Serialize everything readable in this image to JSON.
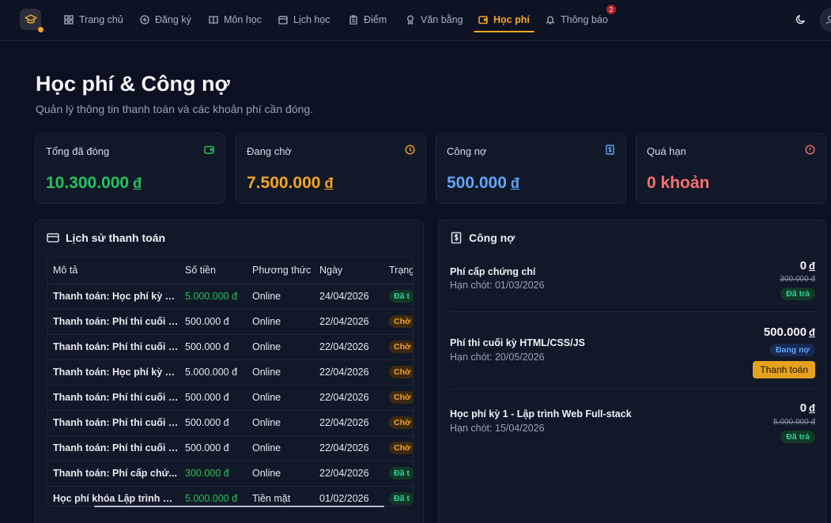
{
  "nav": {
    "items": [
      {
        "label": "Trang chủ",
        "icon": "grid-icon",
        "active": false
      },
      {
        "label": "Đăng ký",
        "icon": "plus-circle-icon",
        "active": false
      },
      {
        "label": "Môn học",
        "icon": "book-icon",
        "active": false
      },
      {
        "label": "Lịch học",
        "icon": "calendar-icon",
        "active": false
      },
      {
        "label": "Điểm",
        "icon": "clipboard-icon",
        "active": false
      },
      {
        "label": "Văn bằng",
        "icon": "award-icon",
        "active": false
      },
      {
        "label": "Học phí",
        "icon": "wallet-icon",
        "active": true
      },
      {
        "label": "Thông báo",
        "icon": "bell-icon",
        "active": false
      }
    ],
    "notif_count": "2",
    "accent": "#f5a524"
  },
  "header": {
    "title": "Học phí & Công nợ",
    "subtitle": "Quản lý thông tin thanh toán và các khoản phí cần đóng."
  },
  "stats": [
    {
      "label": "Tổng đã đóng",
      "value": "10.300.000",
      "currency": "đ",
      "color": "#22c55e",
      "icon": "wallet-icon"
    },
    {
      "label": "Đang chờ",
      "value": "7.500.000",
      "currency": "đ",
      "color": "#f5a524",
      "icon": "clock-icon"
    },
    {
      "label": "Công nợ",
      "value": "500.000",
      "currency": "đ",
      "color": "#60a5fa",
      "icon": "dollar-receipt-icon"
    },
    {
      "label": "Quá hạn",
      "value": "0 khoản",
      "currency": "",
      "color": "#f87171",
      "icon": "alert-circle-icon"
    }
  ],
  "history": {
    "title": "Lịch sử thanh toán",
    "columns": [
      "Mô tả",
      "Số tiền",
      "Phương thức",
      "Ngày",
      "Trạng"
    ],
    "rows": [
      {
        "desc": "Thanh toán: Học phí kỳ 1 ...",
        "amount": "5.000.000 đ",
        "green": true,
        "method": "Online",
        "date": "24/04/2026",
        "status": "Đã t",
        "status_type": "paid"
      },
      {
        "desc": "Thanh toán: Phí thi cuối k...",
        "amount": "500.000 đ",
        "green": false,
        "method": "Online",
        "date": "22/04/2026",
        "status": "Chờ",
        "status_type": "pending"
      },
      {
        "desc": "Thanh toán: Phí thi cuối k...",
        "amount": "500.000 đ",
        "green": false,
        "method": "Online",
        "date": "22/04/2026",
        "status": "Chờ",
        "status_type": "pending"
      },
      {
        "desc": "Thanh toán: Học phí kỳ 1 ...",
        "amount": "5.000.000 đ",
        "green": false,
        "method": "Online",
        "date": "22/04/2026",
        "status": "Chờ",
        "status_type": "pending"
      },
      {
        "desc": "Thanh toán: Phí thi cuối k...",
        "amount": "500.000 đ",
        "green": false,
        "method": "Online",
        "date": "22/04/2026",
        "status": "Chờ",
        "status_type": "pending"
      },
      {
        "desc": "Thanh toán: Phí thi cuối k...",
        "amount": "500.000 đ",
        "green": false,
        "method": "Online",
        "date": "22/04/2026",
        "status": "Chờ",
        "status_type": "pending"
      },
      {
        "desc": "Thanh toán: Phí thi cuối k...",
        "amount": "500.000 đ",
        "green": false,
        "method": "Online",
        "date": "22/04/2026",
        "status": "Chờ",
        "status_type": "pending"
      },
      {
        "desc": "Thanh toán: Phí cấp chứ...",
        "amount": "300.000 đ",
        "green": true,
        "method": "Online",
        "date": "22/04/2026",
        "status": "Đã t",
        "status_type": "paid"
      },
      {
        "desc": "Học phí khóa Lập trình W...",
        "amount": "5.000.000 đ",
        "green": true,
        "method": "Tiền mặt",
        "date": "01/02/2026",
        "status": "Đã t",
        "status_type": "paid"
      }
    ]
  },
  "debts": {
    "title": "Công nợ",
    "items": [
      {
        "name": "Phí cấp chứng chỉ",
        "due": "Hạn chót: 01/03/2026",
        "amount": "0",
        "currency": "đ",
        "old": "300.000 đ",
        "status": "Đã trả",
        "status_type": "paid",
        "action": ""
      },
      {
        "name": "Phí thi cuối kỳ HTML/CSS/JS",
        "due": "Hạn chót: 20/05/2026",
        "amount": "500.000",
        "currency": "đ",
        "old": "",
        "status": "Đang nợ",
        "status_type": "owe",
        "action": "Thanh toán"
      },
      {
        "name": "Học phí kỳ 1 - Lập trình Web Full-stack",
        "due": "Hạn chót: 15/04/2026",
        "amount": "0",
        "currency": "đ",
        "old": "5.000.000 đ",
        "status": "Đã trả",
        "status_type": "paid",
        "action": ""
      }
    ]
  }
}
